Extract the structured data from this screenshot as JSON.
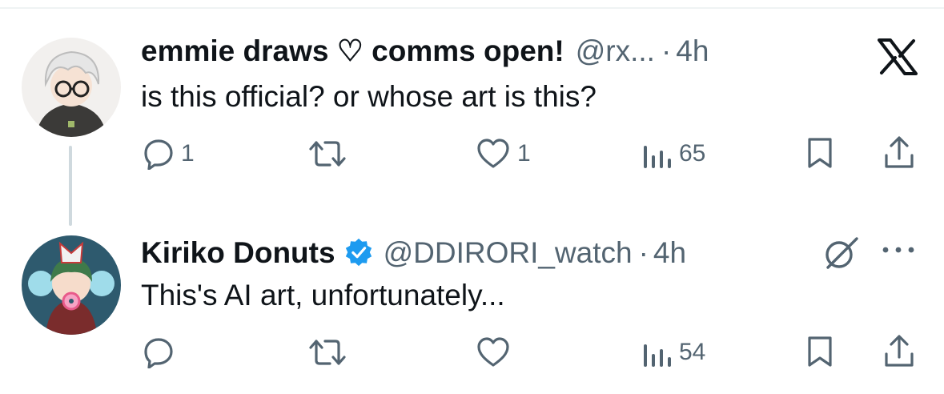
{
  "app": {
    "logo_icon": "x-logo-icon"
  },
  "colors": {
    "text": "#0f1419",
    "secondary": "#536471",
    "verified": "#1d9bf0",
    "thread_line": "#cfd9de"
  },
  "tweets": [
    {
      "display_name": "emmie draws ♡ comms open!",
      "handle": "@rx...",
      "separator": "·",
      "time": "4h",
      "text": "is this official? or whose art is this?",
      "actions": {
        "replies": "1",
        "retweets": "",
        "likes": "1",
        "views": "65"
      }
    },
    {
      "display_name": "Kiriko Donuts",
      "verified": true,
      "handle": "@DDIRORI_watch",
      "separator": "·",
      "time": "4h",
      "text": "This's AI art, unfortunately...",
      "actions": {
        "replies": "",
        "retweets": "",
        "likes": "",
        "views": "54"
      }
    }
  ]
}
